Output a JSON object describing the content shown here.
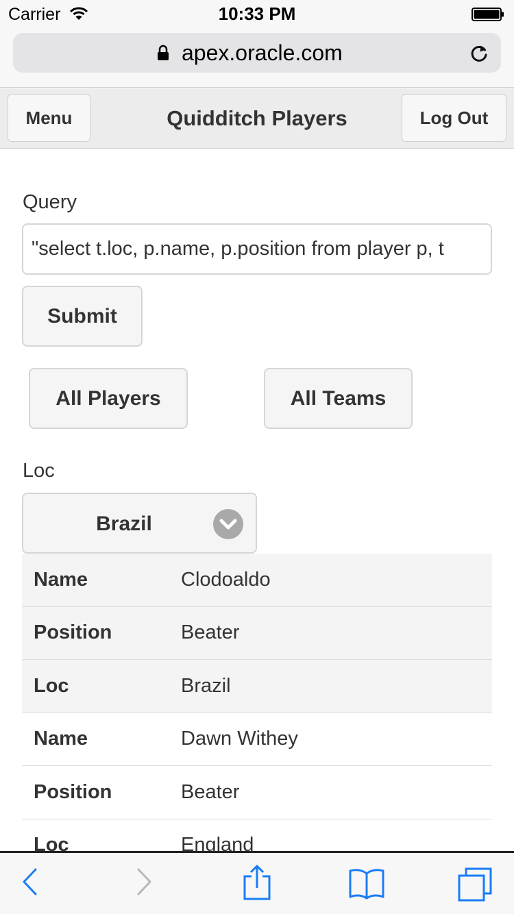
{
  "status_bar": {
    "carrier": "Carrier",
    "time": "10:33 PM"
  },
  "browser": {
    "url": "apex.oracle.com"
  },
  "header": {
    "menu_label": "Menu",
    "title": "Quidditch Players",
    "logout_label": "Log Out"
  },
  "form": {
    "query_label": "Query",
    "query_value": "\"select t.loc, p.name, p.position from player p, t",
    "submit_label": "Submit",
    "all_players_label": "All Players",
    "all_teams_label": "All Teams",
    "loc_label": "Loc",
    "loc_selected": "Brazil"
  },
  "results": [
    {
      "label": "Name",
      "value": "Clodoaldo",
      "shaded": true
    },
    {
      "label": "Position",
      "value": "Beater",
      "shaded": true
    },
    {
      "label": "Loc",
      "value": "Brazil",
      "shaded": true
    },
    {
      "label": "Name",
      "value": "Dawn Withey",
      "shaded": false
    },
    {
      "label": "Position",
      "value": "Beater",
      "shaded": false
    },
    {
      "label": "Loc",
      "value": "England",
      "shaded": false
    }
  ],
  "toolbar": {
    "icons": [
      "back-icon",
      "forward-icon",
      "share-icon",
      "bookmarks-icon",
      "tabs-icon"
    ],
    "accent_color": "#1a7cf5",
    "disabled_color": "#b8b8bc"
  }
}
